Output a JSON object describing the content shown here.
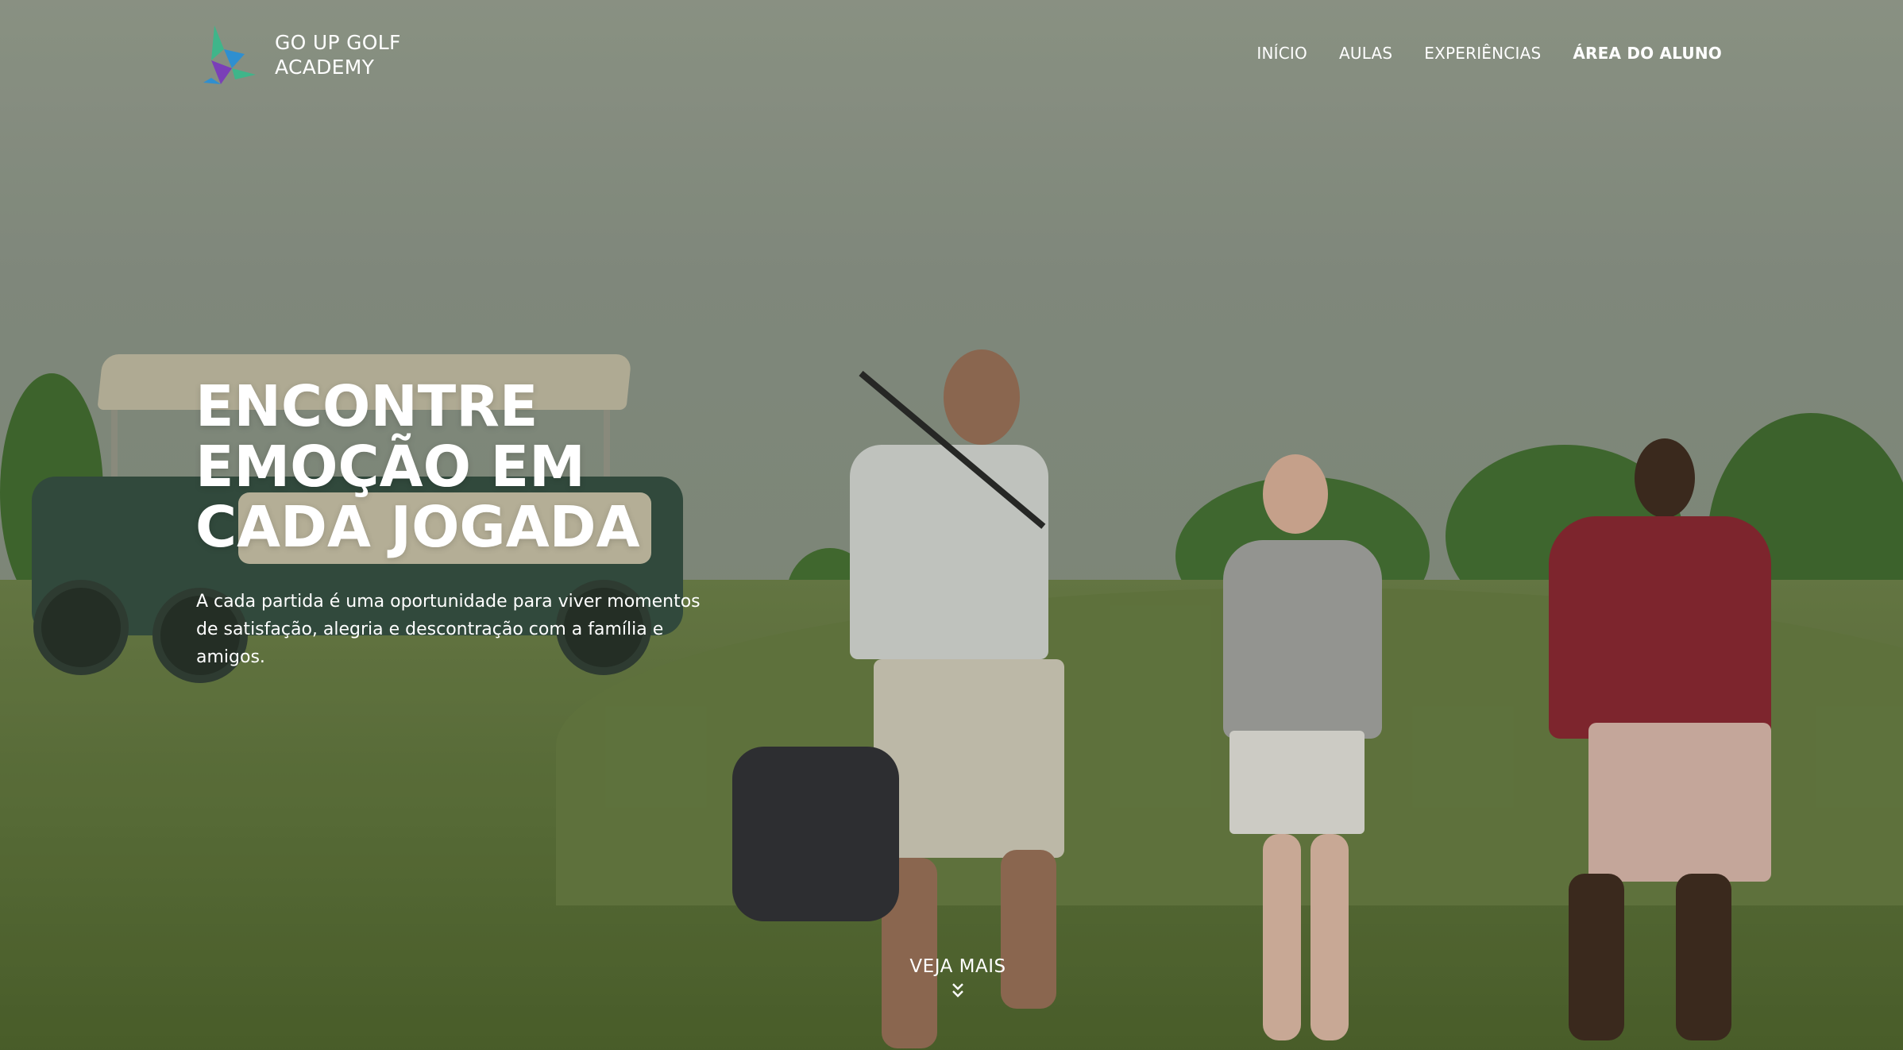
{
  "brand": {
    "line1": "GO UP GOLF",
    "line2": "ACADEMY",
    "logo_icon": "bird-logo-icon"
  },
  "nav": {
    "items": [
      {
        "label": "INÍCIO"
      },
      {
        "label": "AULAS"
      },
      {
        "label": "EXPERIÊNCIAS"
      },
      {
        "label": "ÁREA DO ALUNO"
      }
    ]
  },
  "hero": {
    "headline_line1": "ENCONTRE",
    "headline_line2": "EMOÇÃO EM",
    "headline_line3": "CADA JOGADA",
    "subtext": "A cada partida é uma oportunidade para viver momentos de satisfação, alegria e descontração com a família e amigos.",
    "cta_label": "VEJA MAIS",
    "cta_icon": "double-chevron-down-icon"
  },
  "colors": {
    "text": "#ffffff",
    "logo_green": "#3fb58a",
    "logo_purple": "#7a3fb8",
    "logo_blue": "#2f8fd0"
  }
}
